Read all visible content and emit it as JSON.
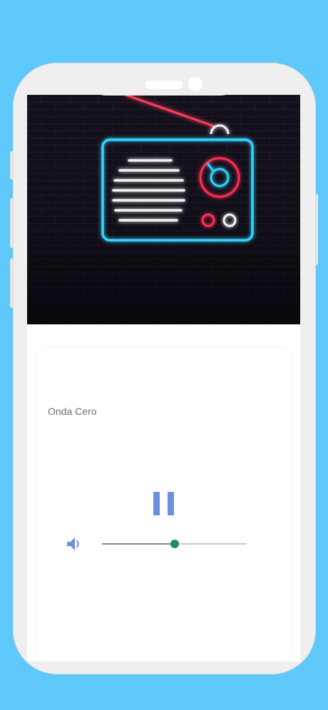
{
  "player": {
    "station_name": "Onda Cero",
    "state": "playing",
    "volume": 0.5
  },
  "icons": {
    "artwork": "neon-radio-image",
    "pause": "pause-icon",
    "volume": "speaker-volume-icon"
  },
  "colors": {
    "background": "#5ec8fb",
    "accent": "#6e8ee2",
    "slider_thumb": "#1a8a74"
  }
}
